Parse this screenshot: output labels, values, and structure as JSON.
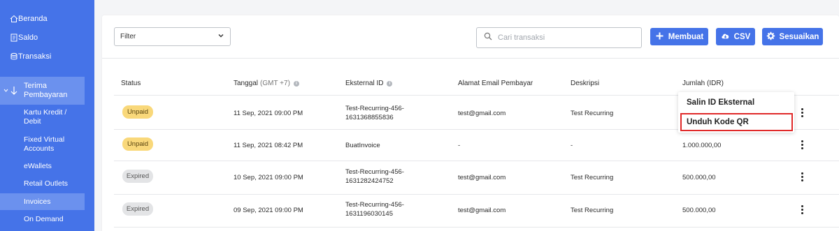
{
  "sidebar": {
    "items": [
      {
        "label": "Beranda",
        "icon": "home-icon"
      },
      {
        "label": "Saldo",
        "icon": "ledger-icon"
      },
      {
        "label": "Transaksi",
        "icon": "database-icon"
      }
    ],
    "group": {
      "label_line1": "Terima",
      "label_line2": "Pembayaran",
      "icon": "arrow-down-icon"
    },
    "sub_items": [
      {
        "line1": "Kartu Kredit /",
        "line2": "Debit"
      },
      {
        "line1": "Fixed Virtual",
        "line2": "Accounts"
      },
      {
        "line1": "eWallets",
        "line2": ""
      },
      {
        "line1": "Retail Outlets",
        "line2": ""
      },
      {
        "line1": "Invoices",
        "line2": ""
      },
      {
        "line1": "On Demand",
        "line2": ""
      }
    ]
  },
  "toolbar": {
    "filter_label": "Filter",
    "search_placeholder": "Cari transaksi",
    "create_label": "Membuat",
    "csv_label": "CSV",
    "customize_label": "Sesuaikan"
  },
  "table": {
    "headers": {
      "status": "Status",
      "date": "Tanggal",
      "date_tz": "(GMT +7)",
      "external_id": "Eksternal ID",
      "email": "Alamat Email Pembayar",
      "description": "Deskripsi",
      "amount": "Jumlah (IDR)"
    },
    "rows": [
      {
        "status": "Unpaid",
        "date": "11 Sep, 2021 09:00 PM",
        "ext1": "Test-Recurring-456-",
        "ext2": "1631368855836",
        "email": "test@gmail.com",
        "desc": "Test Recurring",
        "amount": ""
      },
      {
        "status": "Unpaid",
        "date": "11 Sep, 2021 08:42 PM",
        "ext1": "BuatInvoice",
        "ext2": "",
        "email": "-",
        "desc": "-",
        "amount": "1.000.000,00"
      },
      {
        "status": "Expired",
        "date": "10 Sep, 2021 09:00 PM",
        "ext1": "Test-Recurring-456-",
        "ext2": "1631282424752",
        "email": "test@gmail.com",
        "desc": "Test Recurring",
        "amount": "500.000,00"
      },
      {
        "status": "Expired",
        "date": "09 Sep, 2021 09:00 PM",
        "ext1": "Test-Recurring-456-",
        "ext2": "1631196030145",
        "email": "test@gmail.com",
        "desc": "Test Recurring",
        "amount": "500.000,00"
      }
    ]
  },
  "menu": {
    "copy_id": "Salin ID Eksternal",
    "download_qr": "Unduh Kode QR"
  },
  "colors": {
    "primary": "#4573e8",
    "highlight": "#e02a2a",
    "unpaid": "#f9d87a",
    "expired": "#e3e4e6"
  }
}
